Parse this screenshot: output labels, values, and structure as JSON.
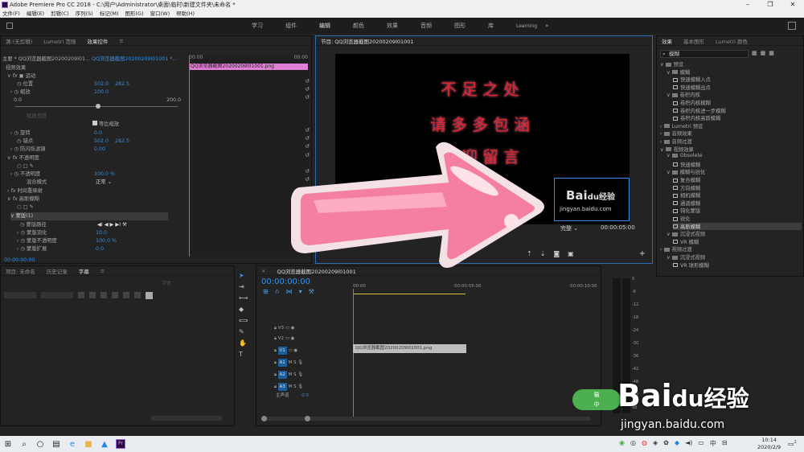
{
  "window": {
    "title": "Adobe Premiere Pro CC 2018 - C:\\用户\\Administrator\\桌面\\临时\\新建文件夹\\未命名 *"
  },
  "menu": [
    "文件(F)",
    "编辑(E)",
    "剪辑(C)",
    "序列(S)",
    "标记(M)",
    "图形(G)",
    "窗口(W)",
    "帮助(H)"
  ],
  "workspaces": [
    "学习",
    "组件",
    "编辑",
    "颜色",
    "效果",
    "音频",
    "图形",
    "库",
    "Learning"
  ],
  "workspace_more": "»",
  "effect_controls": {
    "tabs": [
      "源:(无剪辑)",
      "Lumetri 范围",
      "效果控件"
    ],
    "master_label": "主要 * QQ浏览器截图20200209l01...",
    "clip_label": "QQ浏览器截图20200209l01001 *...",
    "timecode_start": "00:00",
    "timecode_end": "00:00",
    "clip_bar_name": "QQ浏览器截图20200209l01001.png",
    "video_effects": "视频效果",
    "motion": "运动",
    "position": "位置",
    "position_x": "502.0",
    "position_y": "282.5",
    "scale": "缩放",
    "scale_value": "100.0",
    "slider_min": "0.0",
    "slider_max": "200.0",
    "scale_width": "缩放宽度",
    "uniform_scale": "等比缩放",
    "rotation": "旋转",
    "rotation_value": "0.0",
    "anchor": "锚点",
    "anchor_x": "502.0",
    "anchor_y": "282.5",
    "anti_flicker": "防闪烁滤镜",
    "anti_flicker_value": "0.00",
    "opacity": "不透明度",
    "opacity_label": "不透明度",
    "opacity_value": "100.0 %",
    "blend_mode": "混合模式",
    "blend_value": "正常",
    "time_remap": "时间重映射",
    "gaussian_blur": "高斯模糊",
    "mask": "蒙版(1)",
    "mask_path": "蒙版路径",
    "mask_feather": "蒙版羽化",
    "mask_feather_value": "10.0",
    "mask_opacity": "蒙版不透明度",
    "mask_opacity_value": "100.0 %",
    "mask_expansion": "蒙版扩展",
    "mask_expansion_value": "0.0",
    "footer_time": "00:00:00:00"
  },
  "program_monitor": {
    "title": "节目: QQ浏览器截图20200209l01001",
    "lines": [
      "不足之处",
      "请多多包涵",
      "欢迎留言"
    ],
    "watermark_main": "Bai",
    "watermark_du": "du经验",
    "watermark_url": "jingyan.baidu.com",
    "quality": "完整",
    "time": "00:00:05:00"
  },
  "project_panel": {
    "tabs": [
      "项目: 未命名",
      "历史记录",
      "字幕"
    ],
    "tab_more": "≡",
    "toolbar_label": "字体"
  },
  "timeline": {
    "title": "QQ浏览器截图20200209l01001",
    "timecode": "00:00:00:00",
    "ruler": [
      "00:00",
      "00:00:05:00",
      "00:00:10:00"
    ],
    "tracks_video": [
      "V3",
      "V2",
      "V1"
    ],
    "tracks_audio": [
      "A1",
      "A2",
      "A3"
    ],
    "master": "主声道",
    "master_value": "0.0",
    "clip_name": "QQ浏览器截图20200209l01001.png"
  },
  "effects_panel": {
    "tabs": [
      "效果",
      "基本图形",
      "Lumetri 颜色"
    ],
    "search": "模糊",
    "tree": [
      {
        "label": "预设",
        "depth": 0,
        "type": "folder"
      },
      {
        "label": "模糊",
        "depth": 1,
        "type": "folder"
      },
      {
        "label": "快速模糊入点",
        "depth": 2,
        "type": "item"
      },
      {
        "label": "快速模糊出点",
        "depth": 2,
        "type": "item"
      },
      {
        "label": "卷积内核",
        "depth": 1,
        "type": "folder"
      },
      {
        "label": "卷积内核模糊",
        "depth": 2,
        "type": "item"
      },
      {
        "label": "卷积内核进一步模糊",
        "depth": 2,
        "type": "item"
      },
      {
        "label": "卷积内核高斯模糊",
        "depth": 2,
        "type": "item"
      },
      {
        "label": "Lumetri 预设",
        "depth": 0,
        "type": "folder"
      },
      {
        "label": "音频效果",
        "depth": 0,
        "type": "folder"
      },
      {
        "label": "音频过渡",
        "depth": 0,
        "type": "folder"
      },
      {
        "label": "视频效果",
        "depth": 0,
        "type": "folder"
      },
      {
        "label": "Obsolete",
        "depth": 1,
        "type": "folder"
      },
      {
        "label": "快速模糊",
        "depth": 2,
        "type": "item"
      },
      {
        "label": "模糊与锐化",
        "depth": 1,
        "type": "folder"
      },
      {
        "label": "复合模糊",
        "depth": 2,
        "type": "item"
      },
      {
        "label": "方向模糊",
        "depth": 2,
        "type": "item"
      },
      {
        "label": "相机模糊",
        "depth": 2,
        "type": "item"
      },
      {
        "label": "通道模糊",
        "depth": 2,
        "type": "item"
      },
      {
        "label": "钝化蒙版",
        "depth": 2,
        "type": "item"
      },
      {
        "label": "锐化",
        "depth": 2,
        "type": "item"
      },
      {
        "label": "高斯模糊",
        "depth": 2,
        "type": "item",
        "selected": true
      },
      {
        "label": "沉浸式视频",
        "depth": 1,
        "type": "folder"
      },
      {
        "label": "VR 模糊",
        "depth": 2,
        "type": "item"
      },
      {
        "label": "视频过渡",
        "depth": 0,
        "type": "folder"
      },
      {
        "label": "沉浸式视频",
        "depth": 1,
        "type": "folder"
      },
      {
        "label": "VR 球形模糊",
        "depth": 2,
        "type": "item"
      }
    ]
  },
  "meters": [
    "0",
    "-6",
    "-12",
    "-18",
    "-24",
    "-30",
    "-36",
    "-42",
    "-48",
    "-54",
    "dB"
  ],
  "overlay_logo": {
    "main": "Bai",
    "du": "du经验",
    "url": "jingyan.baidu.com",
    "badge_top": "猫",
    "badge_bottom": "中"
  },
  "taskbar": {
    "time": "10:14",
    "date": "2020/2/9",
    "lang": "中",
    "notif": "2"
  },
  "colors": {
    "accent": "#3b8de0",
    "clip_pink": "#e07fd5",
    "arrow": "#f47fa0",
    "arrow_outline": "#f4e1e6",
    "text_red": "#e0252a"
  }
}
